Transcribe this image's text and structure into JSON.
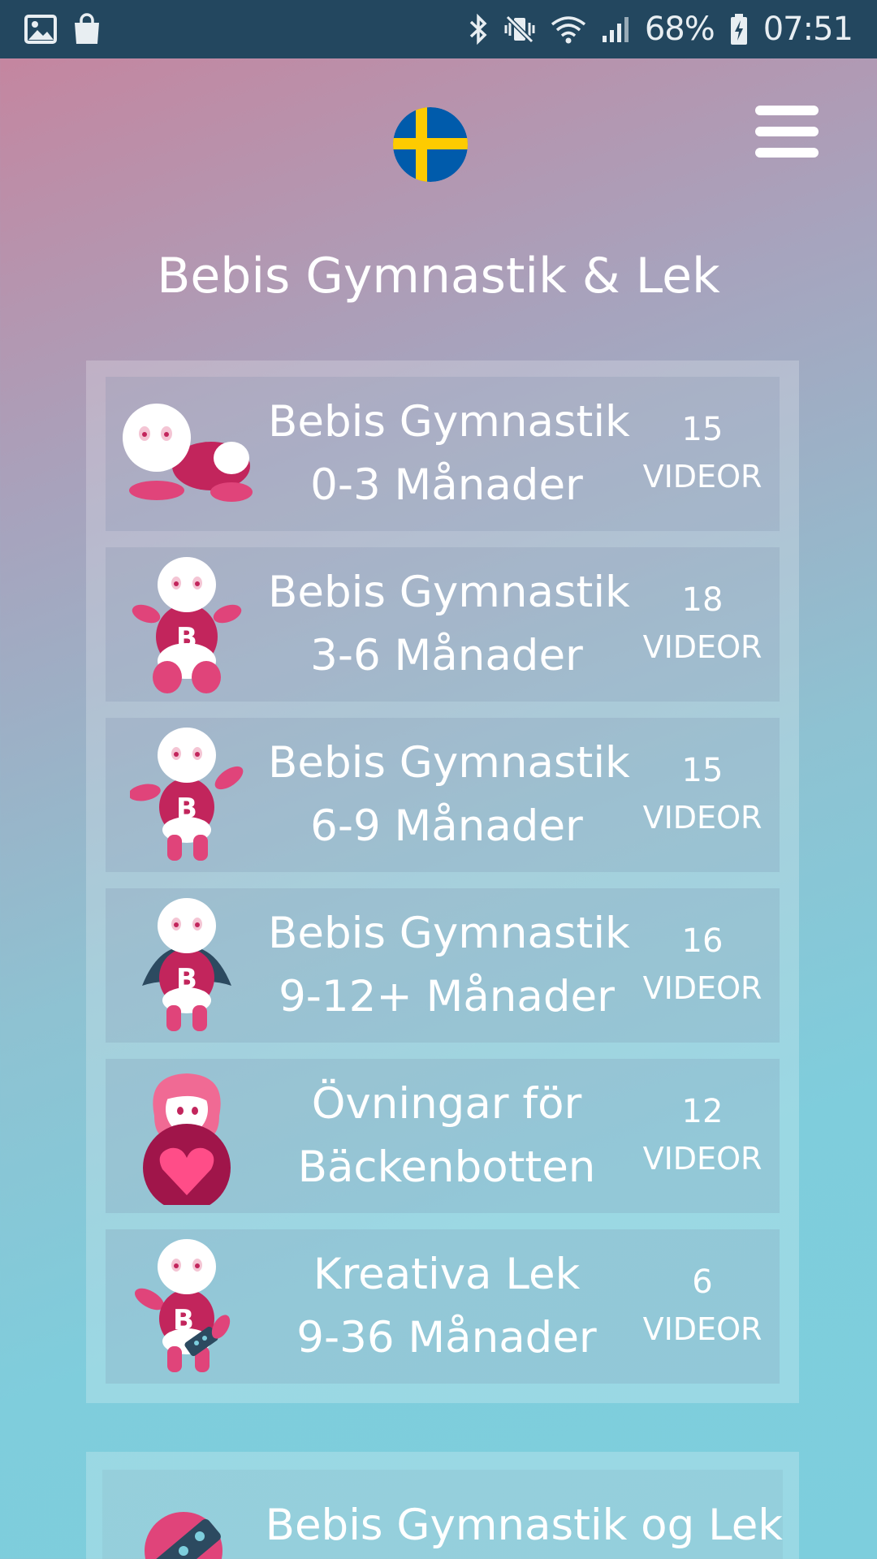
{
  "status_bar": {
    "battery": "68%",
    "time": "07:51",
    "left_icons": [
      "gallery-icon",
      "shopping-bag-icon"
    ],
    "right_icons": [
      "bluetooth-icon",
      "vibrate-mute-icon",
      "wifi-icon",
      "signal-icon",
      "battery-charging-icon"
    ]
  },
  "header": {
    "language_flag": "sweden-flag-icon",
    "menu_icon": "hamburger-menu-icon"
  },
  "page_title": "Bebis Gymnastik & Lek",
  "categories": [
    {
      "line1": "Bebis Gymnastik",
      "line2": "0-3 Månader",
      "count": "15",
      "count_label": "VIDEOR",
      "icon": "crawling-baby-icon"
    },
    {
      "line1": "Bebis Gymnastik",
      "line2": "3-6 Månader",
      "count": "18",
      "count_label": "VIDEOR",
      "icon": "sitting-baby-icon"
    },
    {
      "line1": "Bebis Gymnastik",
      "line2": "6-9 Månader",
      "count": "15",
      "count_label": "VIDEOR",
      "icon": "standing-baby-icon"
    },
    {
      "line1": "Bebis Gymnastik",
      "line2": "9-12+ Månader",
      "count": "16",
      "count_label": "VIDEOR",
      "icon": "superhero-baby-icon"
    },
    {
      "line1": "Övningar för",
      "line2": "Bäckenbotten",
      "count": "12",
      "count_label": "VIDEOR",
      "icon": "mother-heart-icon"
    },
    {
      "line1": "Kreativa Lek",
      "line2": "9-36 Månader",
      "count": "6",
      "count_label": "VIDEOR",
      "icon": "playing-baby-icon"
    }
  ],
  "secondary_card": {
    "title": "Bebis Gymnastik og Lek",
    "icon": "ball-icon"
  },
  "colors": {
    "status_bar": "#23475f",
    "accent_pink": "#c2255c",
    "flag_blue": "#005bab",
    "flag_yellow": "#fecb00"
  }
}
